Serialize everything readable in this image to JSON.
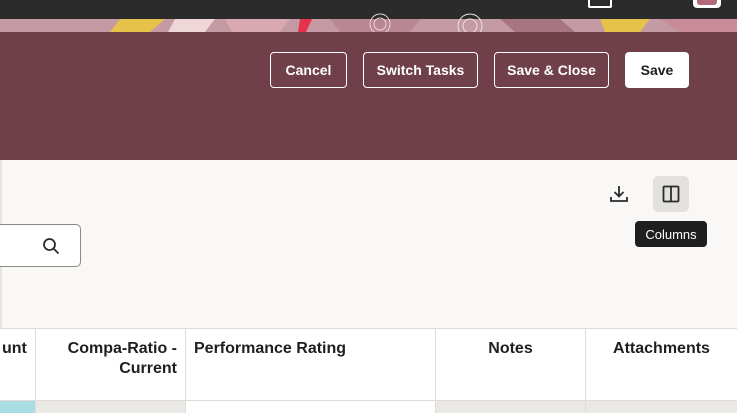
{
  "header": {
    "buttons": {
      "cancel": "Cancel",
      "switch_tasks": "Switch Tasks",
      "save_close": "Save & Close",
      "save": "Save"
    }
  },
  "toolbar": {
    "tooltip": "Columns"
  },
  "search": {
    "value": "",
    "placeholder": ""
  },
  "table": {
    "columns": [
      {
        "label": "unt"
      },
      {
        "label": "Compa-Ratio - Current"
      },
      {
        "label": "Performance Rating"
      },
      {
        "label": "Notes"
      },
      {
        "label": "Attachments"
      }
    ]
  },
  "colors": {
    "header_band": "#6f3f4a",
    "content_bg": "#f9f8f6",
    "tooltip_bg": "#1f1f1f",
    "first_cell_accent": "#a8dde4"
  },
  "icons": {
    "download": "download-icon",
    "columns": "columns-icon",
    "search": "search-icon"
  }
}
